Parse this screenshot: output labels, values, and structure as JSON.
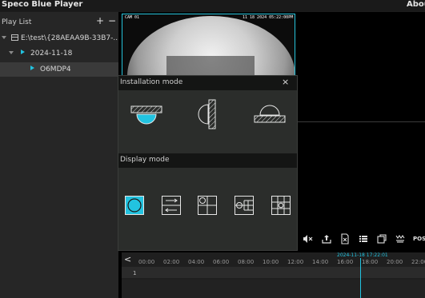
{
  "titlebar": {
    "app_title": "Speco Blue Player",
    "about_label": "Abou"
  },
  "sidebar": {
    "title": "Play List",
    "add_label": "+",
    "remove_label": "−",
    "tree": [
      {
        "label": "E:\\test\\{28AEAA9B-33B7-..."
      },
      {
        "label": "2024-11-18"
      },
      {
        "label": "O6MDP4"
      }
    ]
  },
  "video": {
    "osd_left": "CAM 01",
    "osd_right": "11 18 2024 05:22:00PM"
  },
  "popup": {
    "installation_title": "Installation mode",
    "close_label": "×",
    "installation_modes": [
      "ceiling-mount-icon",
      "wall-mount-icon",
      "floor-mount-icon"
    ],
    "display_title": "Display mode",
    "display_modes": [
      "original-view-icon",
      "panorama-view-icon",
      "quad-view-icon",
      "split-view-icon",
      "grid-view-icon"
    ],
    "selected_display_mode": 0
  },
  "toolbar": {
    "icons": [
      "mute-icon",
      "export-icon",
      "clip-icon",
      "list-icon",
      "window-icon",
      "dewarp-icon"
    ],
    "pos_label": "POS"
  },
  "timeline": {
    "back_label": "<",
    "ticks": [
      "00:00",
      "02:00",
      "04:00",
      "06:00",
      "08:00",
      "10:00",
      "12:00",
      "14:00",
      "16:00",
      "18:00",
      "20:00",
      "22:00"
    ],
    "cursor_time": "2024-11-18 17:22:01",
    "track_number": "1"
  },
  "colors": {
    "accent": "#22c3e0",
    "popup_bg": "#2b2d2b",
    "section_bg": "#141514"
  }
}
